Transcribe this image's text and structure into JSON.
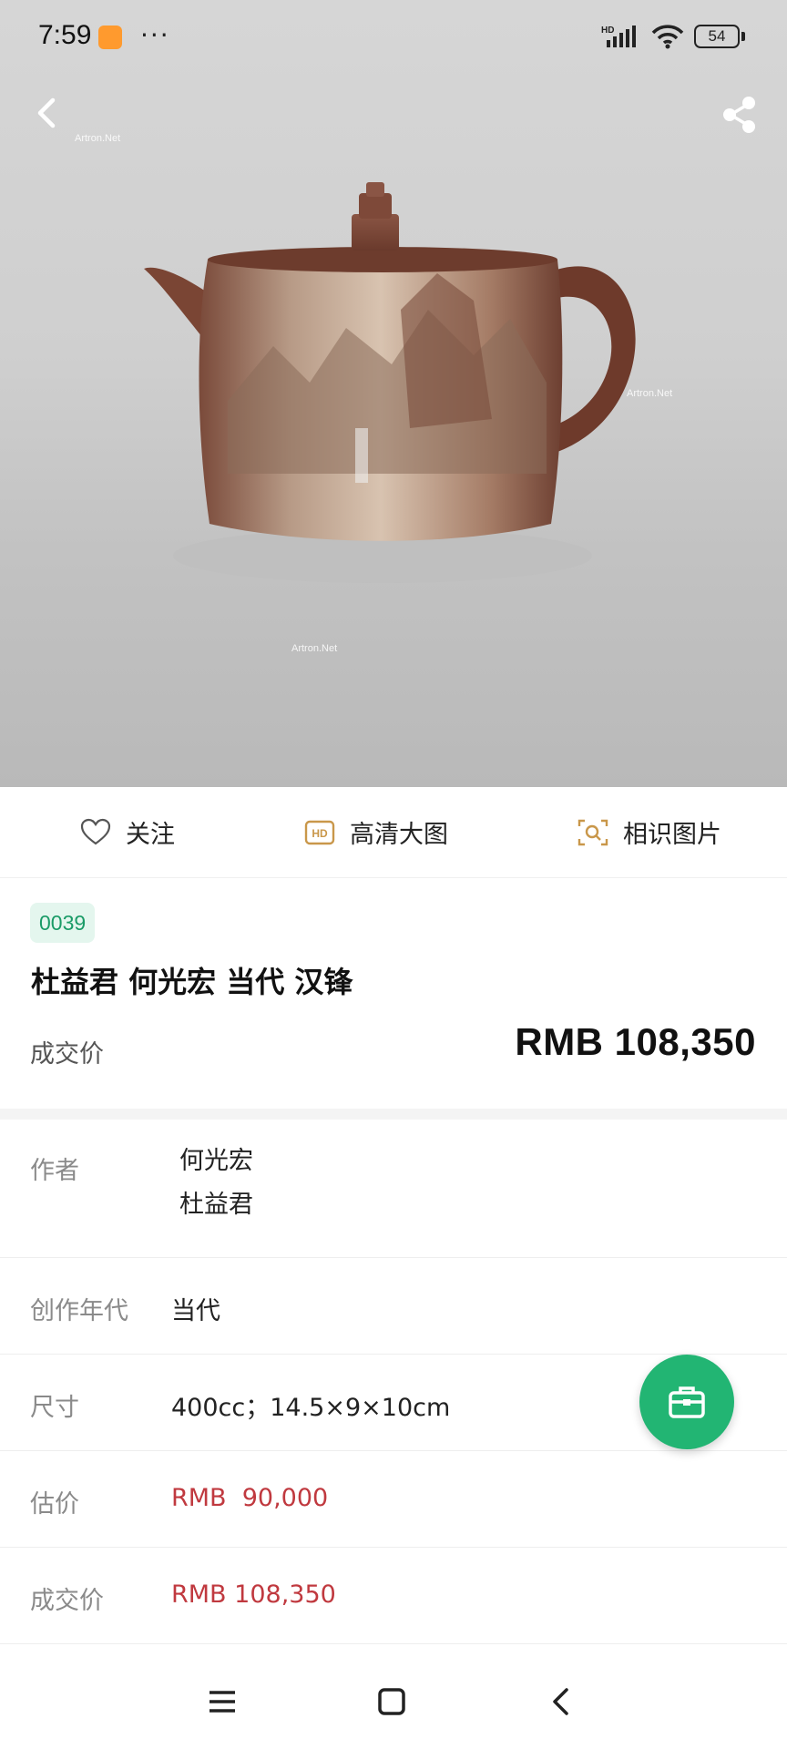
{
  "status_bar": {
    "time": "7:59",
    "dots": "···",
    "network_label": "HD",
    "battery": "54"
  },
  "hero": {
    "image_subject": "teapot",
    "watermark": "Artron.Net"
  },
  "actions": {
    "follow_label": "关注",
    "hd_label": "高清大图",
    "similar_label": "相识图片"
  },
  "lot": {
    "number": "0039",
    "title": "杜益君 何光宏 当代 汉锋",
    "price_label": "成交价",
    "price_value": "RMB 108,350"
  },
  "details": {
    "author_label": "作者",
    "authors": [
      "何光宏",
      "杜益君"
    ],
    "year_label": "创作年代",
    "year_value": "当代",
    "size_label": "尺寸",
    "size_value": "400cc；14.5×9×10cm",
    "estimate_label": "估价",
    "estimate_value": "RMB  90,000",
    "deal_label": "成交价",
    "deal_value": "RMB 108,350"
  },
  "colors": {
    "accent_green": "#22b573",
    "badge_text": "#1a9b67",
    "price_red": "#c0393f",
    "icon_gold": "#c9974a"
  },
  "icons": {
    "back": "chevron-left-icon",
    "share": "share-icon",
    "follow": "heart-icon",
    "hd": "hd-icon",
    "similar": "image-search-icon",
    "fab": "briefcase-icon"
  }
}
